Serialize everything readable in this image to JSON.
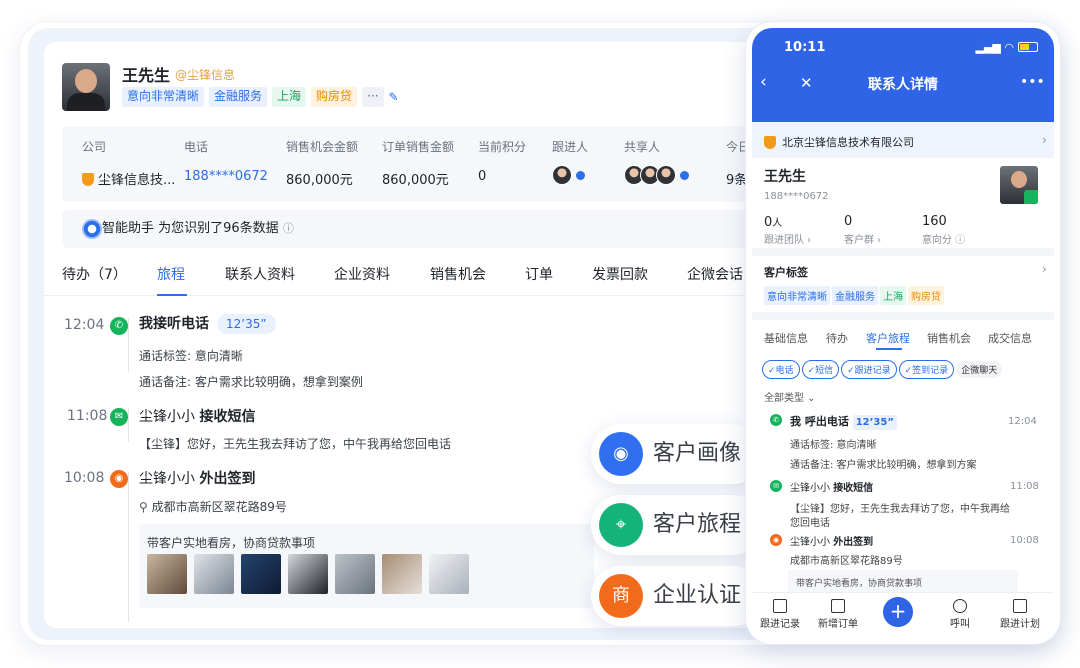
{
  "contact": {
    "name": "王先生",
    "company_handle": "@尘锋信息",
    "tags": [
      "意向非常清晰",
      "金融服务",
      "上海",
      "购房贷",
      "···"
    ]
  },
  "info": {
    "columns": [
      {
        "label": "公司",
        "value": "尘锋信息技..."
      },
      {
        "label": "电话",
        "value": "188****0672"
      },
      {
        "label": "销售机会金额",
        "value": "860,000元"
      },
      {
        "label": "订单销售金额",
        "value": "860,000元"
      },
      {
        "label": "当前积分",
        "value": "0"
      },
      {
        "label": "跟进人",
        "value": ""
      },
      {
        "label": "共享人",
        "value": ""
      },
      {
        "label": "今日",
        "value": "9条"
      }
    ]
  },
  "assistant": {
    "text": "智能助手 为您识别了96条数据",
    "info": "ⓘ"
  },
  "tabs": [
    "待办（7）",
    "旅程",
    "联系人资料",
    "企业资料",
    "销售机会",
    "订单",
    "发票回款",
    "企微会话"
  ],
  "timeline": [
    {
      "time": "12:04",
      "actor": "我",
      "action": "接听电话",
      "duration": "12’35”",
      "label_line": "通话标签: 意向清晰",
      "note_line": "通话备注: 客户需求比较明确，想拿到案例"
    },
    {
      "time": "11:08",
      "actor": "尘锋小小",
      "action": "接收短信",
      "message": "【尘锋】您好，王先生我去拜访了您，中午我再给您回电话"
    },
    {
      "time": "10:08",
      "actor": "尘锋小小",
      "action": "外出签到",
      "address": "成都市高新区翠花路89号",
      "note": "带客户实地看房，协商贷款事项"
    }
  ],
  "features": [
    {
      "label": "客户画像",
      "icon": "portrait-icon",
      "color": "#2f6ff0"
    },
    {
      "label": "客户旅程",
      "icon": "journey-icon",
      "color": "#14b37a"
    },
    {
      "label": "企业认证",
      "icon": "shang-badge-icon",
      "glyph": "商",
      "color": "#f26b1d"
    }
  ],
  "phone": {
    "time": "10:11",
    "title": "联系人详情",
    "company": "北京尘锋信息技术有限公司",
    "name": "王先生",
    "phone": "188****0672",
    "stats": [
      {
        "value": "0",
        "unit": "人",
        "label": "跟进团队 ›"
      },
      {
        "value": "0",
        "unit": "",
        "label": "客户群 ›"
      },
      {
        "value": "160",
        "unit": "",
        "label": "意向分 ⓘ"
      }
    ],
    "tags_title": "客户标签",
    "tags": [
      "意向非常清晰",
      "金融服务",
      "上海",
      "购房贷"
    ],
    "tabs": [
      "基础信息",
      "待办",
      "客户旅程",
      "销售机会",
      "成交信息"
    ],
    "filters": [
      "✓电话",
      "✓短信",
      "✓跟进记录",
      "✓签到记录",
      "企微聊天"
    ],
    "type_filter": "全部类型 ⌄",
    "events": [
      {
        "actor": "我",
        "action": "呼出电话",
        "duration": "12’35”",
        "time": "12:04",
        "line1": "通话标签:  意向清晰",
        "line2": "通话备注: 客户需求比较明确，想拿到方案"
      },
      {
        "actor": "尘锋小小",
        "action": "接收短信",
        "time": "11:08",
        "line1": "【尘锋】您好，王先生我去拜访了您，中午我再给",
        "line2": "您回电话"
      },
      {
        "actor": "尘锋小小",
        "action": "外出签到",
        "time": "10:08",
        "line1": "成都市高新区翠花路89号",
        "line2": "带客户实地看房，协商贷款事项"
      }
    ],
    "bottom": [
      "跟进记录",
      "新增订单",
      "+",
      "呼叫",
      "跟进计划"
    ]
  }
}
